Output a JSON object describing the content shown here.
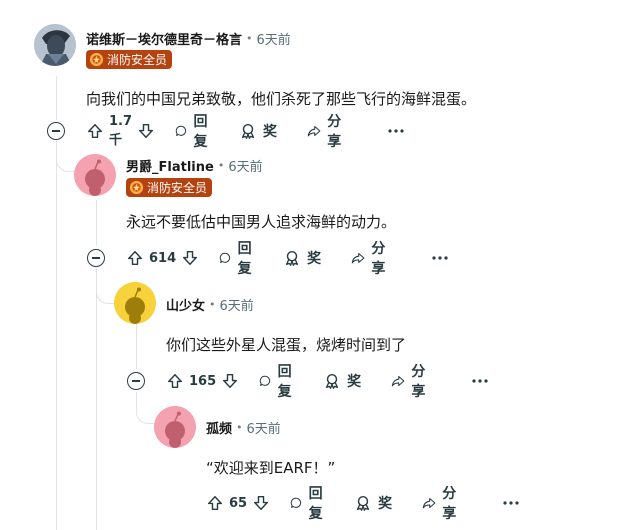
{
  "comments": [
    {
      "author": "诺维斯－埃尔德里奇－格言",
      "time": "6天前",
      "flair": "消防安全员",
      "body": "向我们的中国兄弟致敬，他们杀死了那些飞行的海鲜混蛋。",
      "votes": "1.7千",
      "reply_label": "回复",
      "award_label": "奖",
      "share_label": "分享"
    },
    {
      "author": "男爵_Flatline",
      "time": "6天前",
      "flair": "消防安全员",
      "body": "永远不要低估中国男人追求海鲜的动力。",
      "votes": "614",
      "reply_label": "回复",
      "award_label": "奖",
      "share_label": "分享"
    },
    {
      "author": "山少女",
      "time": "6天前",
      "body": "你们这些外星人混蛋，烧烤时间到了",
      "votes": "165",
      "reply_label": "回复",
      "award_label": "奖",
      "share_label": "分享"
    },
    {
      "author": "孤频",
      "time": "6天前",
      "body": "“欢迎来到EARF！”",
      "votes": "65",
      "reply_label": "回复",
      "award_label": "奖",
      "share_label": "分享"
    }
  ],
  "separator": "•",
  "colors": {
    "flair_bg": "#b54310",
    "snoo_pink": "#f4a1b0",
    "snoo_yellow": "#f8d23a",
    "thread": "#e0e3e6"
  }
}
